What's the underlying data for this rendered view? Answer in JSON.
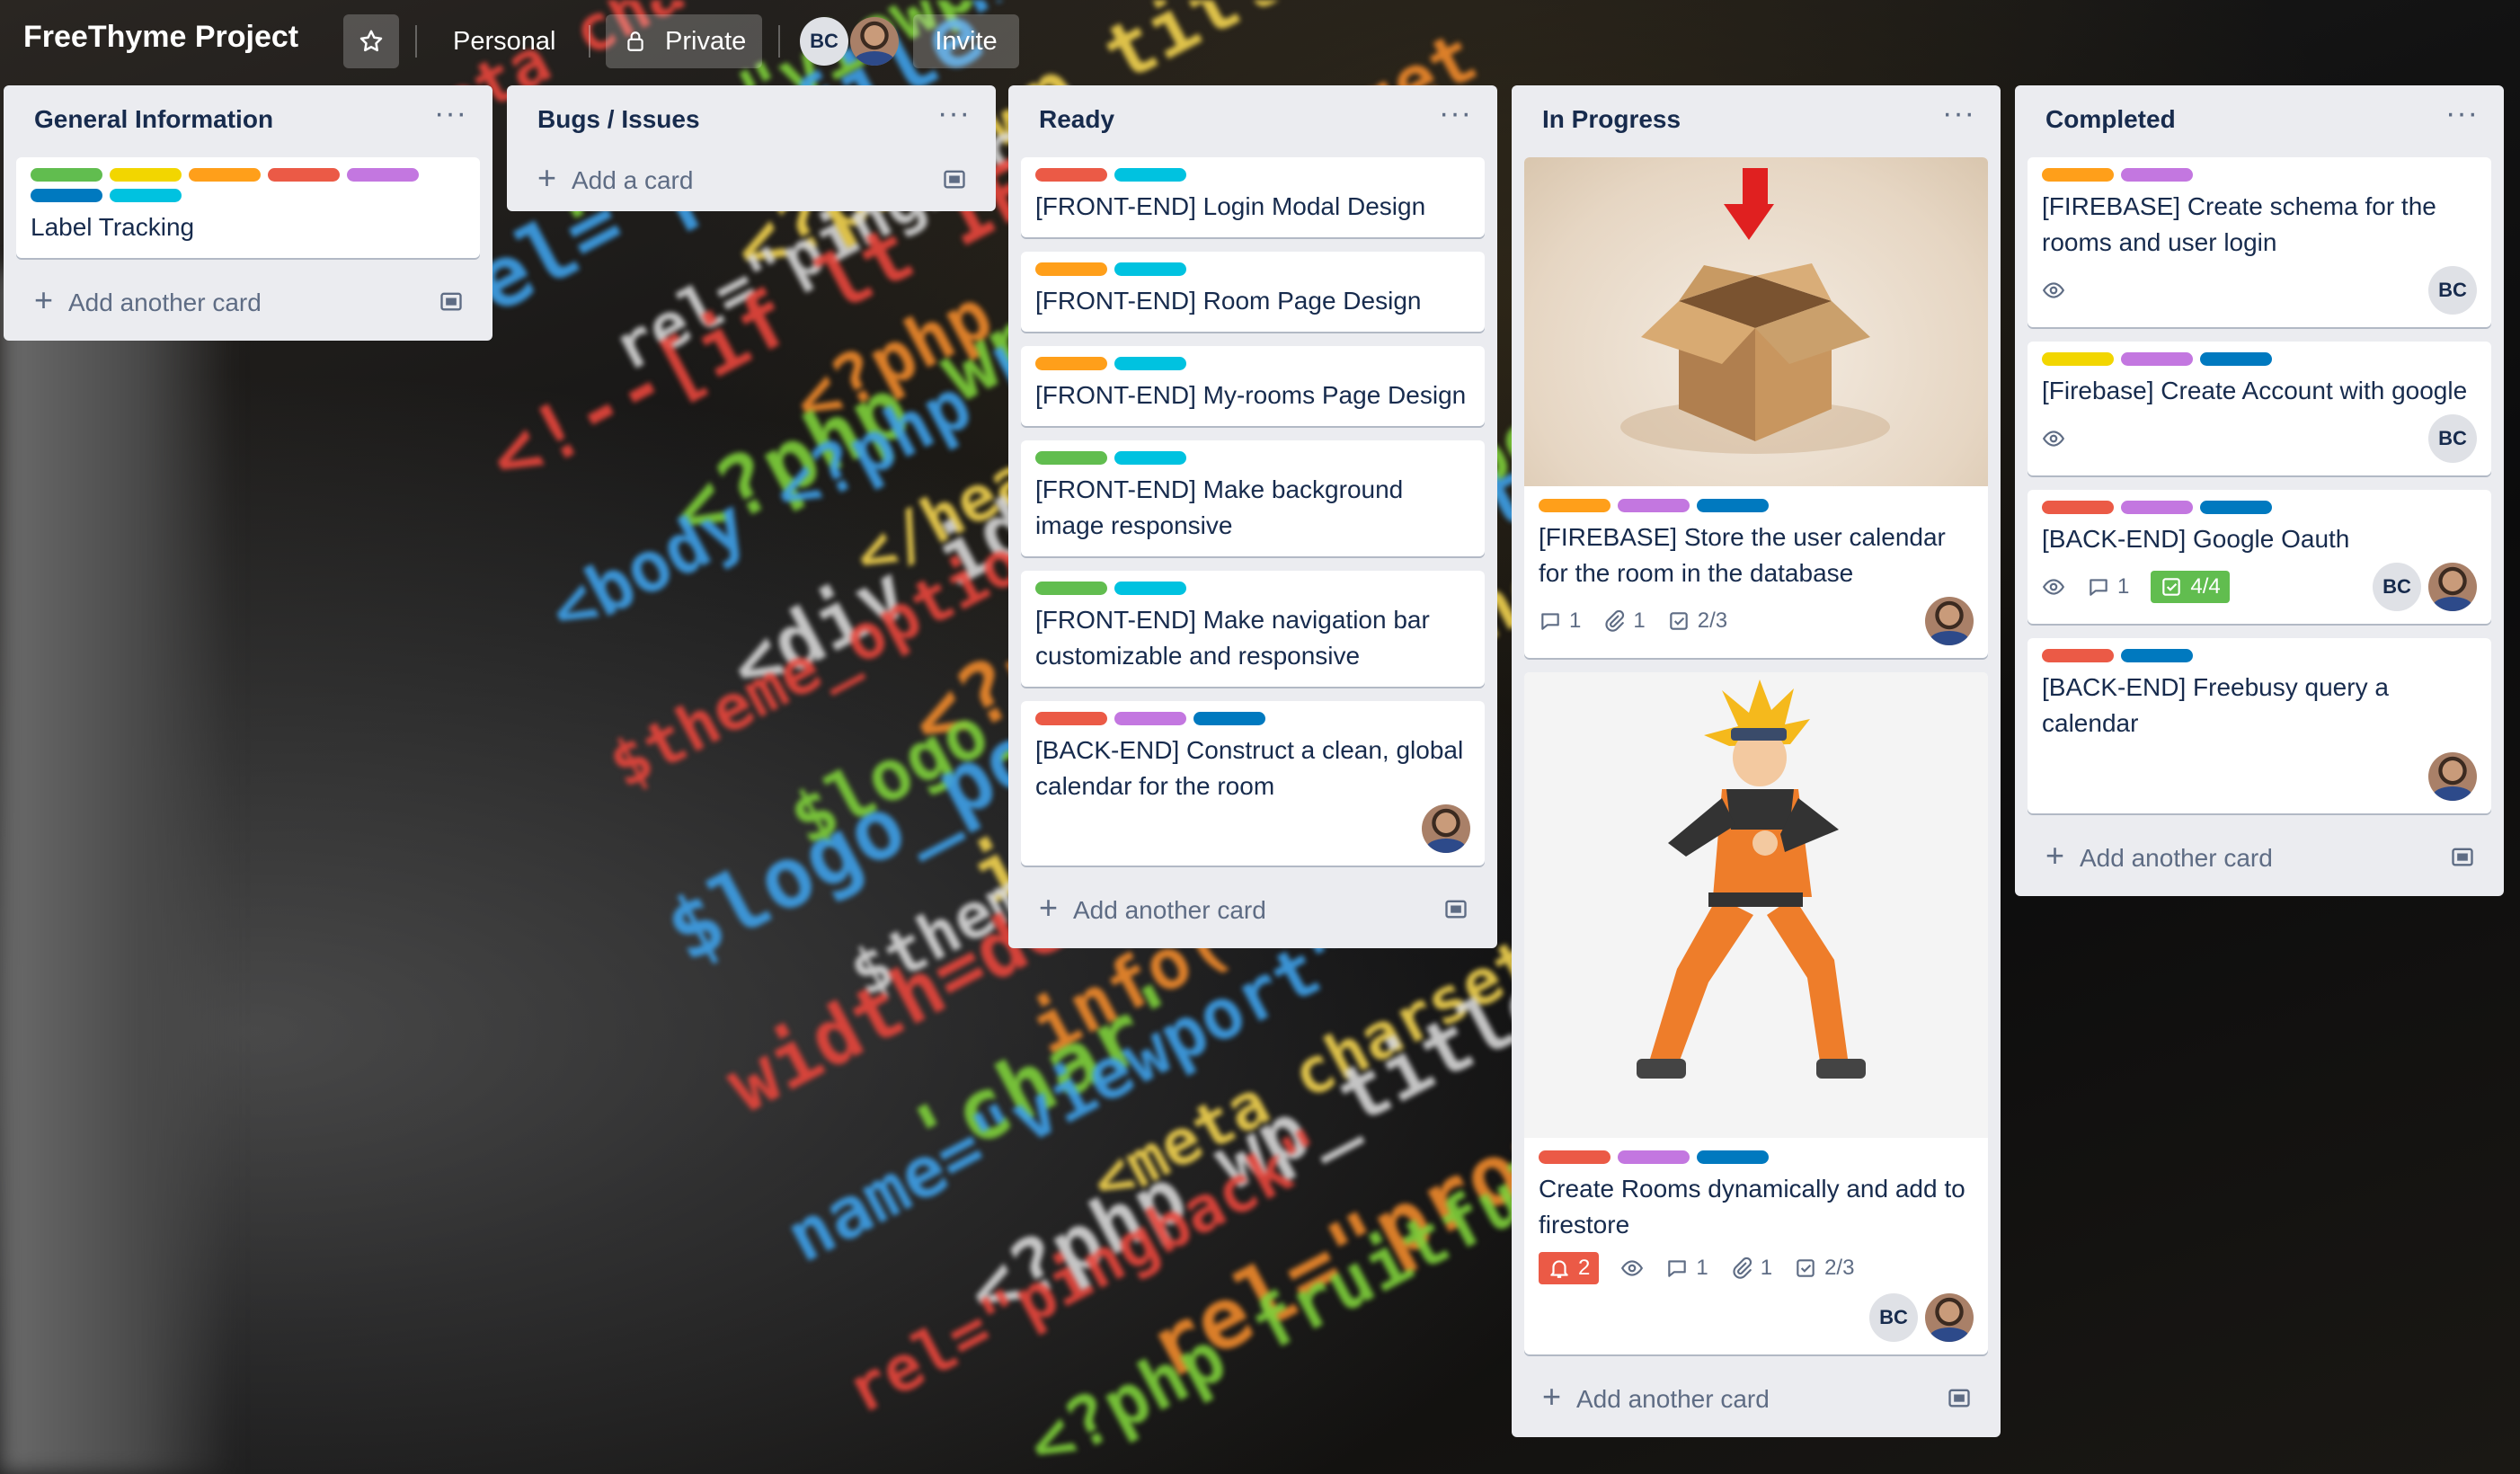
{
  "header": {
    "board_title": "FreeThyme Project",
    "star_icon": "star-icon",
    "personal": "Personal",
    "private": "Private",
    "member_initials": "BC",
    "invite": "Invite"
  },
  "colors": {
    "green": "#61bd4f",
    "yellow": "#f2d600",
    "orange": "#ff9f1a",
    "red": "#eb5a46",
    "purple": "#c377e0",
    "blue": "#0079bf",
    "sky": "#00c2e0"
  },
  "lists": [
    {
      "title": "General Information",
      "add_label": "Add another card",
      "cards": [
        {
          "title": "Label Tracking",
          "labels": [
            "green",
            "yellow",
            "orange",
            "red",
            "purple",
            "blue",
            "sky"
          ]
        }
      ]
    },
    {
      "title": "Bugs / Issues",
      "add_label": "Add a card",
      "cards": []
    },
    {
      "title": "Ready",
      "add_label": "Add another card",
      "cards": [
        {
          "title": "[FRONT-END] Login Modal Design",
          "labels": [
            "red",
            "sky"
          ]
        },
        {
          "title": "[FRONT-END] Room Page Design",
          "labels": [
            "orange",
            "sky"
          ]
        },
        {
          "title": "[FRONT-END] My-rooms Page Design",
          "labels": [
            "orange",
            "sky"
          ]
        },
        {
          "title": "[FRONT-END] Make background image responsive",
          "labels": [
            "green",
            "sky"
          ]
        },
        {
          "title": "[FRONT-END] Make navigation bar customizable and responsive",
          "labels": [
            "green",
            "sky"
          ]
        },
        {
          "title": "[BACK-END] Construct a clean, global calendar for the room",
          "labels": [
            "red",
            "purple",
            "blue"
          ]
        }
      ]
    },
    {
      "title": "In Progress",
      "add_label": "Add another card",
      "cards": [
        {
          "title": "[FIREBASE] Store the user calendar for the room in the database",
          "labels": [
            "orange",
            "purple",
            "blue"
          ],
          "comments": "1",
          "attachments": "1",
          "checklist": "2/3"
        },
        {
          "title": "Create Rooms dynamically and add to firestore",
          "labels": [
            "red",
            "purple",
            "blue"
          ],
          "notifications": "2",
          "comments": "1",
          "attachments": "1",
          "checklist": "2/3",
          "member_initials": "BC"
        }
      ]
    },
    {
      "title": "Completed",
      "add_label": "Add another card",
      "cards": [
        {
          "title": "[FIREBASE] Create schema for the rooms and user login",
          "labels": [
            "orange",
            "purple"
          ],
          "member_initials": "BC"
        },
        {
          "title": "[Firebase] Create Account with google",
          "labels": [
            "yellow",
            "purple",
            "blue"
          ],
          "member_initials": "BC"
        },
        {
          "title": "[BACK-END] Google Oauth",
          "labels": [
            "red",
            "purple",
            "blue"
          ],
          "comments": "1",
          "checklist": "4/4",
          "member_initials": "BC"
        },
        {
          "title": "[BACK-END] Freebusy query a calendar",
          "labels": [
            "red",
            "blue"
          ]
        }
      ]
    }
  ]
}
